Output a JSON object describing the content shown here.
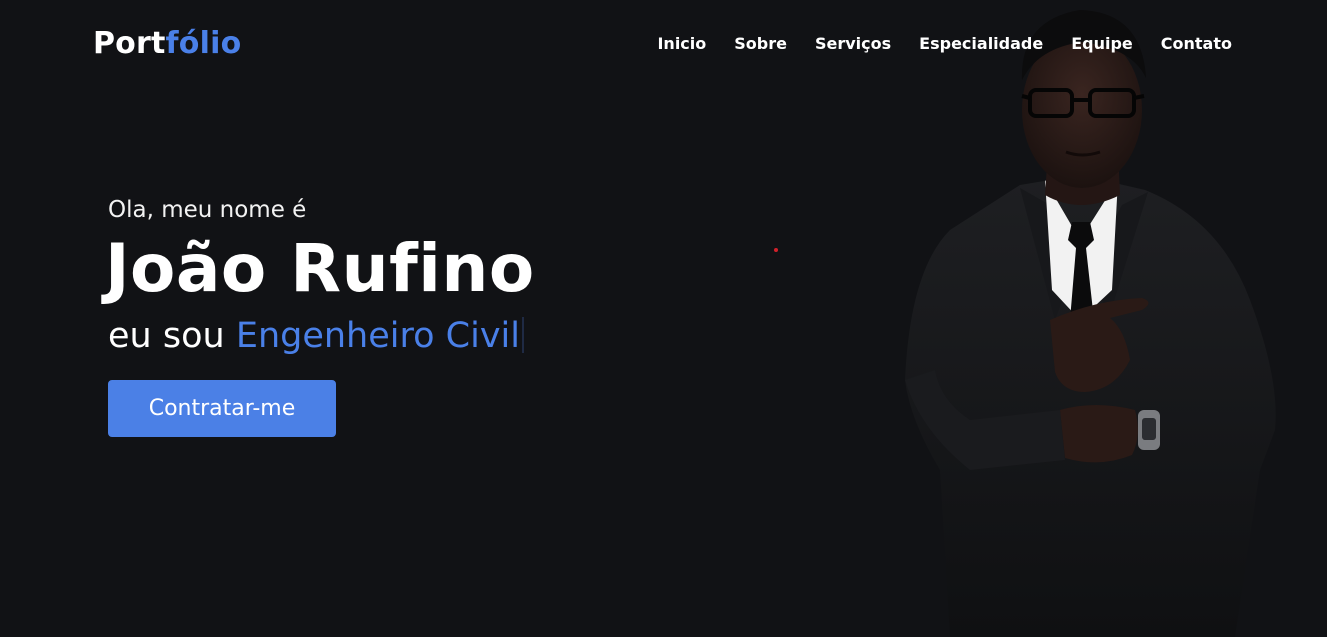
{
  "navbar": {
    "logo_part1": "Port",
    "logo_part2": "fólio",
    "menu": [
      {
        "label": "Inicio"
      },
      {
        "label": "Sobre"
      },
      {
        "label": "Serviços"
      },
      {
        "label": "Especialidade"
      },
      {
        "label": "Equipe"
      },
      {
        "label": "Contato"
      }
    ]
  },
  "hero": {
    "greeting": "Ola, meu nome é",
    "name": "João Rufino",
    "role_prefix": "eu sou",
    "role": "Engenheiro Civil",
    "cta_label": "Contratar-me"
  },
  "colors": {
    "background": "#111215",
    "accent": "#4a80e8",
    "text": "#ffffff"
  }
}
